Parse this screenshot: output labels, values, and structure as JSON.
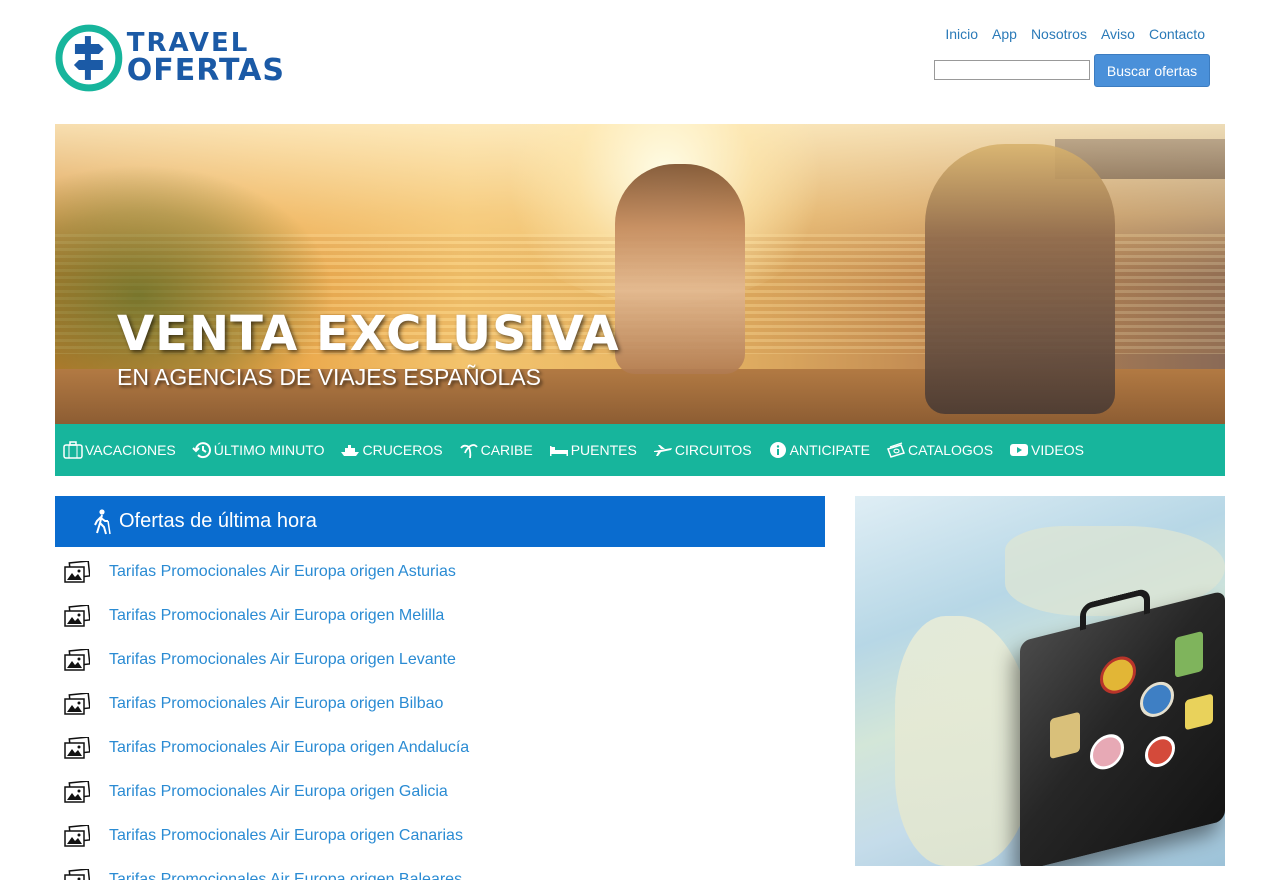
{
  "brand": {
    "line1": "TRAVEL",
    "line2": "OFERTAS"
  },
  "topnav": {
    "items": [
      "Inicio",
      "App",
      "Nosotros",
      "Aviso",
      "Contacto"
    ]
  },
  "search": {
    "value": "",
    "button_label": "Buscar ofertas"
  },
  "hero": {
    "title": "VENTA EXCLUSIVA",
    "subtitle": "EN AGENCIAS DE VIAJES ESPAÑOLAS"
  },
  "categories": [
    {
      "label": "VACACIONES",
      "icon": "suitcase-icon"
    },
    {
      "label": "ÚLTIMO MINUTO",
      "icon": "history-icon"
    },
    {
      "label": "CRUCEROS",
      "icon": "ship-icon"
    },
    {
      "label": "CARIBE",
      "icon": "palm-tree-icon"
    },
    {
      "label": "PUENTES",
      "icon": "bed-icon"
    },
    {
      "label": "CIRCUITOS",
      "icon": "plane-icon"
    },
    {
      "label": "ANTICIPATE",
      "icon": "info-icon"
    },
    {
      "label": "CATALOGOS",
      "icon": "money-icon"
    },
    {
      "label": "VIDEOS",
      "icon": "youtube-icon"
    }
  ],
  "offers": {
    "title": "Ofertas de última hora",
    "items": [
      "Tarifas Promocionales Air Europa origen Asturias",
      "Tarifas Promocionales Air Europa origen Melilla",
      "Tarifas Promocionales Air Europa origen Levante",
      "Tarifas Promocionales Air Europa origen Bilbao",
      "Tarifas Promocionales Air Europa origen Andalucía",
      "Tarifas Promocionales Air Europa origen Galicia",
      "Tarifas Promocionales Air Europa origen Canarias",
      "Tarifas Promocionales Air Europa origen Baleares"
    ]
  },
  "colors": {
    "brand_blue": "#1b5aa6",
    "brand_teal": "#17b59c",
    "link_blue": "#2a8bd3",
    "offers_header": "#0a6ccf",
    "search_button": "#4a90d9"
  }
}
